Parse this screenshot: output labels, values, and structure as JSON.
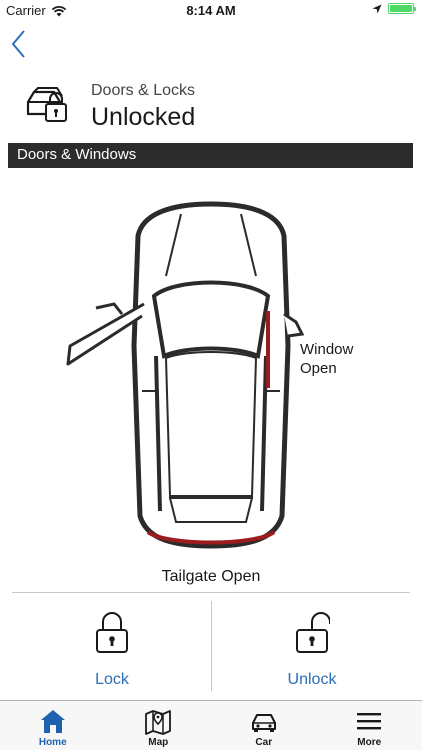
{
  "status_bar": {
    "carrier": "Carrier",
    "time": "8:14 AM",
    "battery_level": 1.0,
    "battery_color": "#4cd964"
  },
  "nav": {
    "back_icon": "chevron-left-icon"
  },
  "header": {
    "icon": "car-lock-icon",
    "subtitle": "Doors & Locks",
    "title": "Unlocked"
  },
  "section": {
    "title": "Doors & Windows"
  },
  "vehicle": {
    "window_status": "Window\nOpen",
    "tailgate_status": "Tailgate Open",
    "highlight_color": "#9b1c1c"
  },
  "actions": {
    "lock_label": "Lock",
    "unlock_label": "Unlock",
    "accent_color": "#2b6fb6"
  },
  "tabs": [
    {
      "label": "Home",
      "icon": "home-icon",
      "active": true
    },
    {
      "label": "Map",
      "icon": "map-icon",
      "active": false
    },
    {
      "label": "Car",
      "icon": "car-icon",
      "active": false
    },
    {
      "label": "More",
      "icon": "menu-icon",
      "active": false
    }
  ]
}
